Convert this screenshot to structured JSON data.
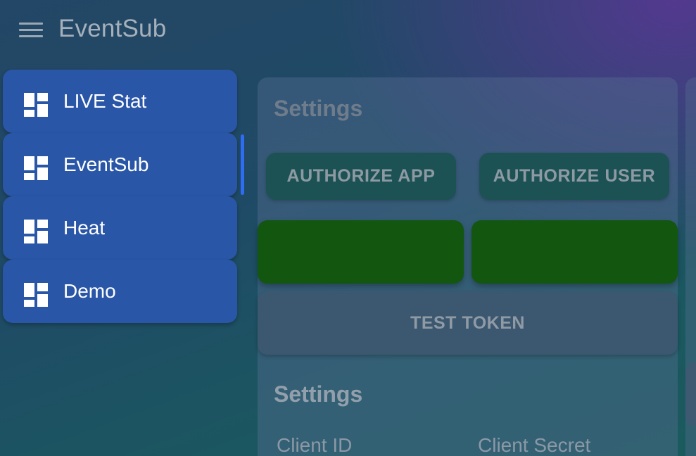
{
  "header": {
    "title": "EventSub",
    "menu_icon": "hamburger-menu-icon"
  },
  "sidebar": {
    "items": [
      {
        "label": "LIVE Stat",
        "icon": "dashboard-icon",
        "active": false
      },
      {
        "label": "EventSub",
        "icon": "dashboard-icon",
        "active": true
      },
      {
        "label": "Heat",
        "icon": "dashboard-icon",
        "active": false
      },
      {
        "label": "Demo",
        "icon": "dashboard-icon",
        "active": false
      }
    ]
  },
  "main": {
    "settings_title": "Settings",
    "authorize_app_label": "AUTHORIZE APP",
    "authorize_user_label": "AUTHORIZE USER",
    "test_token_label": "TEST TOKEN",
    "settings_title_2": "Settings",
    "client_id_label": "Client ID",
    "client_secret_label": "Client Secret"
  },
  "colors": {
    "nav_item_bg": "#2a56a7",
    "active_indicator": "#2f6cf5",
    "status_green": "#125610",
    "authorize_button_bg": "#1d5255"
  }
}
